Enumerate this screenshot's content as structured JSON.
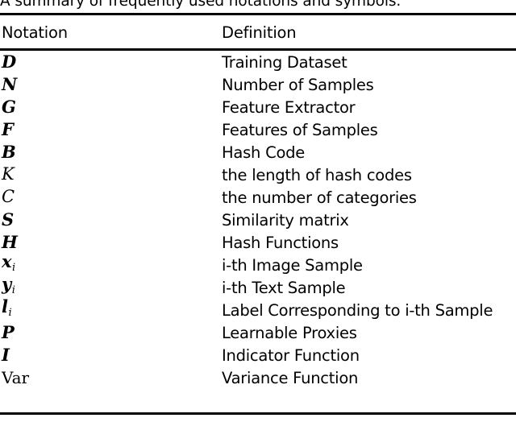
{
  "figure": {
    "caption": "A summary of frequently used notations and symbols.",
    "caption_clipped": true
  },
  "table": {
    "columns": [
      {
        "key": "notation",
        "header": "Notation"
      },
      {
        "key": "definition",
        "header": "Definition"
      }
    ],
    "rows": [
      {
        "notation": "D",
        "notation_style": "bold-italic",
        "subscript": "",
        "definition": "Training Dataset"
      },
      {
        "notation": "N",
        "notation_style": "bold-italic",
        "subscript": "",
        "definition": "Number of Samples"
      },
      {
        "notation": "G",
        "notation_style": "bold-italic",
        "subscript": "",
        "definition": "Feature Extractor"
      },
      {
        "notation": "F",
        "notation_style": "bold-italic",
        "subscript": "",
        "definition": "Features of Samples"
      },
      {
        "notation": "B",
        "notation_style": "bold-italic",
        "subscript": "",
        "definition": "Hash Code"
      },
      {
        "notation": "K",
        "notation_style": "italic",
        "subscript": "",
        "definition": "the length of hash codes"
      },
      {
        "notation": "C",
        "notation_style": "italic",
        "subscript": "",
        "definition": "the number of categories"
      },
      {
        "notation": "S",
        "notation_style": "bold-italic",
        "subscript": "",
        "definition": "Similarity matrix"
      },
      {
        "notation": "H",
        "notation_style": "bold-italic",
        "subscript": "",
        "definition": "Hash Functions"
      },
      {
        "notation": "x",
        "notation_style": "bold-italic",
        "subscript": "i",
        "definition": "i-th Image Sample"
      },
      {
        "notation": "y",
        "notation_style": "bold-italic",
        "subscript": "i",
        "definition": "i-th Text Sample"
      },
      {
        "notation": "l",
        "notation_style": "bold-italic",
        "subscript": "i",
        "definition": "Label Corresponding to i-th Sample"
      },
      {
        "notation": "P",
        "notation_style": "bold-italic",
        "subscript": "",
        "definition": "Learnable Proxies"
      },
      {
        "notation": "I",
        "notation_style": "bold-italic",
        "subscript": "",
        "definition": "Indicator Function"
      },
      {
        "notation": "Var",
        "notation_style": "roman",
        "subscript": "",
        "definition": "Variance Function"
      }
    ]
  },
  "style": {
    "rule_color": "#000000",
    "text_color": "#000000",
    "background": "#ffffff"
  }
}
